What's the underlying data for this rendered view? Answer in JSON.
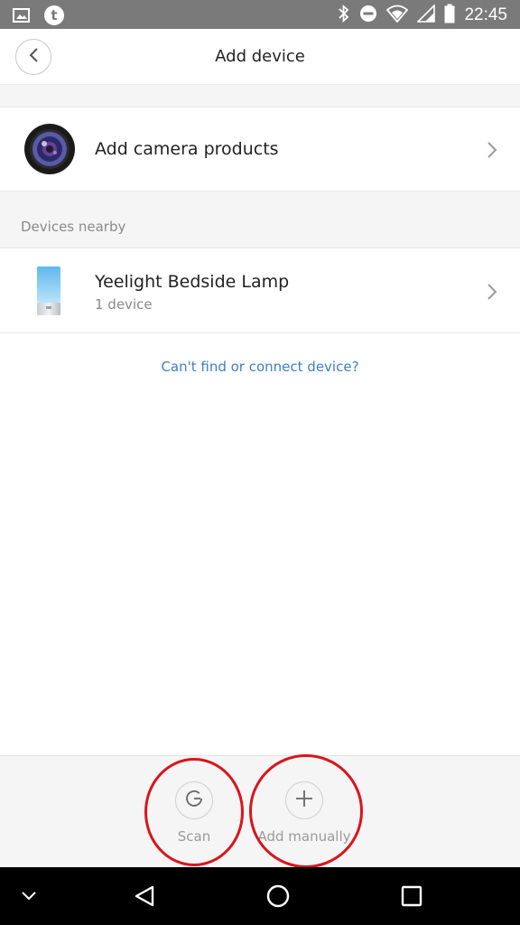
{
  "status_bar": {
    "time": "22:45",
    "left_icons": [
      "image-icon",
      "tumblr-icon"
    ],
    "right_icons": [
      "bluetooth-icon",
      "do-not-disturb-icon",
      "wifi-icon",
      "signal-icon",
      "battery-icon"
    ]
  },
  "header": {
    "title": "Add device",
    "back_icon": "chevron-left-icon"
  },
  "camera_row": {
    "label": "Add camera products",
    "icon": "camera-lens-icon"
  },
  "nearby": {
    "section_label": "Devices nearby",
    "items": [
      {
        "name": "Yeelight Bedside Lamp",
        "subtitle": "1 device",
        "icon": "bedside-lamp-icon"
      }
    ]
  },
  "help_link": "Can't find or connect device?",
  "actions": {
    "scan_label": "Scan",
    "add_manually_label": "Add manually"
  },
  "annotations": {
    "highlight_color": "#d9151c"
  },
  "nav_bar": {
    "buttons": [
      "chevron-down-icon",
      "back-triangle-icon",
      "home-circle-icon",
      "recents-square-icon"
    ]
  },
  "colors": {
    "link": "#3f7fc7",
    "status_bar": "#7a7a7a",
    "background": "#f5f5f5"
  }
}
